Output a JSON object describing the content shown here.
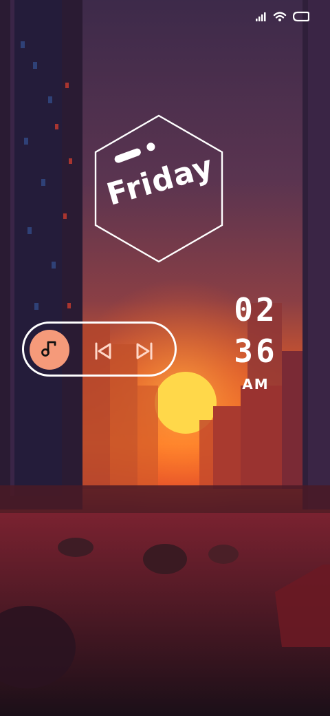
{
  "status_bar": {
    "icons": [
      "signal-icon",
      "wifi-icon",
      "battery-icon"
    ]
  },
  "day_widget": {
    "day": "Friday"
  },
  "music_widget": {
    "icons": [
      "music-note-icon",
      "skip-previous-icon",
      "skip-next-icon"
    ],
    "accent_color": "#f59a7a"
  },
  "clock": {
    "hour": "02",
    "minute": "36",
    "period": "AM"
  },
  "colors": {
    "text": "#ffffff",
    "sky_top": "#4a2f52",
    "sunset": "#ff6a1f",
    "sun": "#ffd84a"
  }
}
